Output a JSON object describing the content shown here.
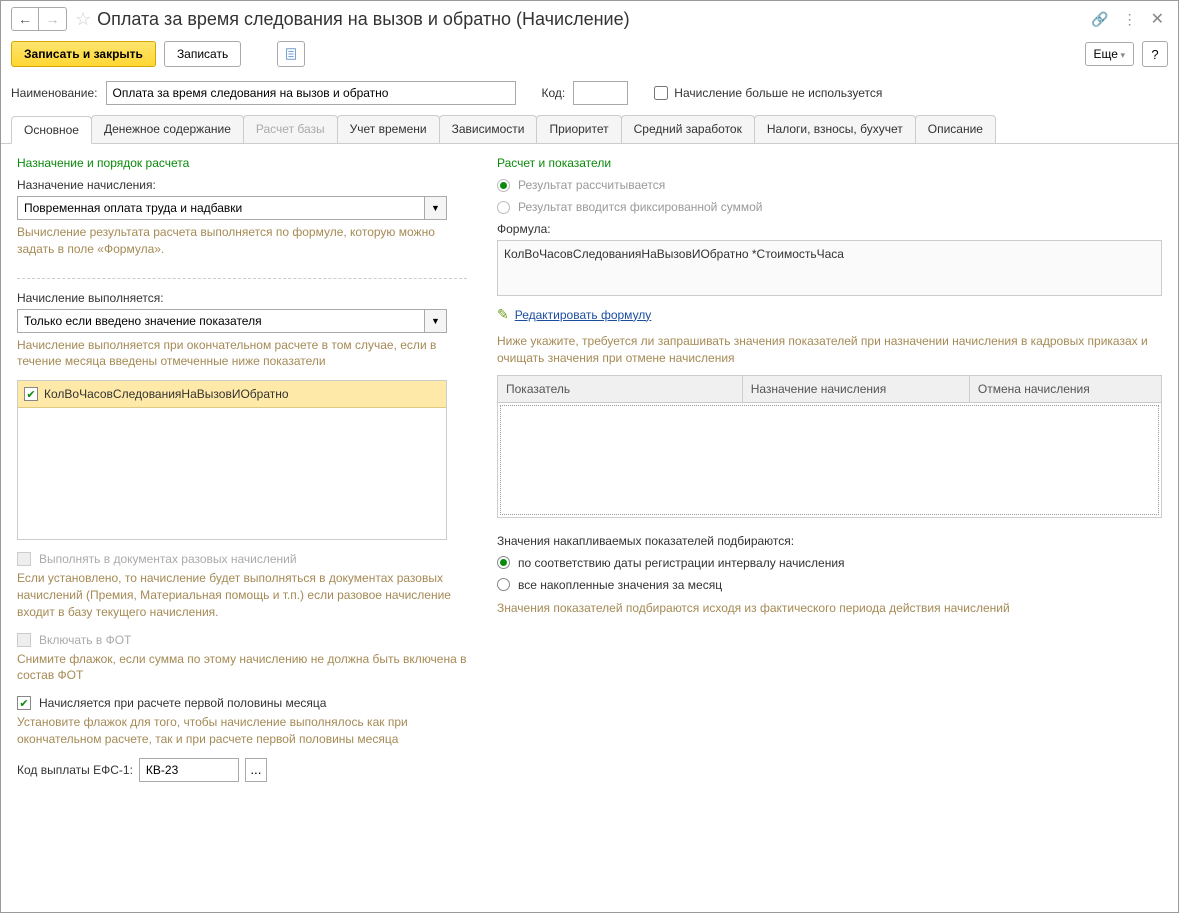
{
  "title": "Оплата за время следования на вызов и обратно (Начисление)",
  "toolbar": {
    "save_close": "Записать и закрыть",
    "save": "Записать",
    "more": "Еще",
    "help": "?"
  },
  "header": {
    "name_label": "Наименование:",
    "name_value": "Оплата за время следования на вызов и обратно",
    "code_label": "Код:",
    "code_value": "",
    "not_used_label": "Начисление больше не используется"
  },
  "tabs": [
    {
      "label": "Основное",
      "active": true
    },
    {
      "label": "Денежное содержание"
    },
    {
      "label": "Расчет базы",
      "disabled": true
    },
    {
      "label": "Учет времени"
    },
    {
      "label": "Зависимости"
    },
    {
      "label": "Приоритет"
    },
    {
      "label": "Средний заработок"
    },
    {
      "label": "Налоги, взносы, бухучет"
    },
    {
      "label": "Описание"
    }
  ],
  "left": {
    "section1": "Назначение и порядок расчета",
    "purpose_label": "Назначение начисления:",
    "purpose_value": "Повременная оплата труда и надбавки",
    "purpose_hint": "Вычисление результата расчета выполняется по формуле, которую можно задать в поле «Формула».",
    "performed_label": "Начисление выполняется:",
    "performed_value": "Только если введено значение показателя",
    "performed_hint": "Начисление выполняется при окончательном расчете в том случае, если в течение месяца введены отмеченные ниже показатели",
    "indicator_item": "КолВоЧасовСледованияНаВызовИОбратно",
    "oneoff_label": "Выполнять в документах разовых начислений",
    "oneoff_hint": "Если установлено, то начисление будет выполняться в документах разовых начислений (Премия, Материальная помощь и т.п.) если разовое начисление входит в базу текущего начисления.",
    "fot_label": "Включать в ФОТ",
    "fot_hint": "Снимите флажок, если сумма по этому начислению не должна быть включена в состав ФОТ",
    "firsthalf_label": "Начисляется при расчете первой половины месяца",
    "firsthalf_hint": "Установите флажок для того, чтобы начисление выполнялось как при окончательном расчете, так и при расчете первой половины месяца",
    "efs_label": "Код выплаты ЕФС-1:",
    "efs_value": "КВ-23"
  },
  "right": {
    "section1": "Расчет и показатели",
    "radio1": "Результат рассчитывается",
    "radio2": "Результат вводится фиксированной суммой",
    "formula_label": "Формула:",
    "formula_value": "КолВоЧасовСледованияНаВызовИОбратно *СтоимостьЧаса",
    "edit_formula": "Редактировать формулу",
    "hint1": "Ниже укажите, требуется ли запрашивать значения показателей при назначении начисления в кадровых приказах и очищать значения при отмене начисления",
    "th1": "Показатель",
    "th2": "Назначение начисления",
    "th3": "Отмена начисления",
    "accum_label": "Значения накапливаемых показателей подбираются:",
    "accum_r1": "по соответствию даты регистрации интервалу начисления",
    "accum_r2": "все накопленные значения за месяц",
    "accum_hint": "Значения показателей подбираются исходя из фактического периода действия начислений"
  }
}
